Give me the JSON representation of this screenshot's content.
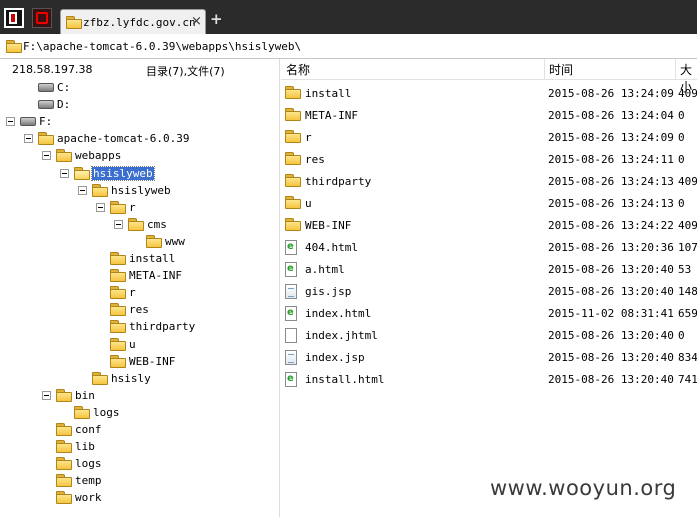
{
  "tab": {
    "title": "zfbz.lyfdc.gov.cn",
    "close": "×",
    "new": "+"
  },
  "address": "F:\\apache-tomcat-6.0.39\\webapps\\hsislyweb\\",
  "left": {
    "ip": "218.58.197.38",
    "summary": "目录(7),文件(7)",
    "tree": [
      {
        "label": "C:",
        "kind": "drive"
      },
      {
        "label": "D:",
        "kind": "drive"
      },
      {
        "label": "F:",
        "kind": "drive",
        "expanded": true
      },
      {
        "label": "apache-tomcat-6.0.39",
        "expanded": true
      },
      {
        "label": "webapps",
        "expanded": true
      },
      {
        "label": "hsislyweb",
        "expanded": true,
        "selected": true,
        "open": true
      },
      {
        "label": "hsislyweb",
        "expanded": true
      },
      {
        "label": "r",
        "expanded": true
      },
      {
        "label": "cms",
        "expanded": true
      },
      {
        "label": "www"
      },
      {
        "label": "install"
      },
      {
        "label": "META-INF"
      },
      {
        "label": "r"
      },
      {
        "label": "res"
      },
      {
        "label": "thirdparty"
      },
      {
        "label": "u"
      },
      {
        "label": "WEB-INF"
      },
      {
        "label": "hsisly"
      },
      {
        "label": "bin",
        "expanded": true
      },
      {
        "label": "logs"
      },
      {
        "label": "conf"
      },
      {
        "label": "lib"
      },
      {
        "label": "logs"
      },
      {
        "label": "temp"
      },
      {
        "label": "work"
      }
    ]
  },
  "list": {
    "columns": {
      "name": "名称",
      "time": "时间",
      "size": "大小"
    },
    "rows": [
      {
        "name": "install",
        "type": "folder",
        "time": "2015-08-26 13:24:09",
        "size": "409"
      },
      {
        "name": "META-INF",
        "type": "folder",
        "time": "2015-08-26 13:24:04",
        "size": "0"
      },
      {
        "name": "r",
        "type": "folder",
        "time": "2015-08-26 13:24:09",
        "size": "0"
      },
      {
        "name": "res",
        "type": "folder",
        "time": "2015-08-26 13:24:11",
        "size": "0"
      },
      {
        "name": "thirdparty",
        "type": "folder",
        "time": "2015-08-26 13:24:13",
        "size": "409"
      },
      {
        "name": "u",
        "type": "folder",
        "time": "2015-08-26 13:24:13",
        "size": "0"
      },
      {
        "name": "WEB-INF",
        "type": "folder",
        "time": "2015-08-26 13:24:22",
        "size": "409"
      },
      {
        "name": "404.html",
        "type": "html",
        "time": "2015-08-26 13:20:36",
        "size": "107"
      },
      {
        "name": "a.html",
        "type": "html",
        "time": "2015-08-26 13:20:40",
        "size": "53"
      },
      {
        "name": "gis.jsp",
        "type": "jsp",
        "time": "2015-08-26 13:20:40",
        "size": "148"
      },
      {
        "name": "index.html",
        "type": "html",
        "time": "2015-11-02 08:31:41",
        "size": "659"
      },
      {
        "name": "index.jhtml",
        "type": "blank",
        "time": "2015-08-26 13:20:40",
        "size": "0"
      },
      {
        "name": "index.jsp",
        "type": "jsp",
        "time": "2015-08-26 13:20:40",
        "size": "834"
      },
      {
        "name": "install.html",
        "type": "html",
        "time": "2015-08-26 13:20:40",
        "size": "741"
      }
    ]
  },
  "watermark": "www.wooyun.org"
}
